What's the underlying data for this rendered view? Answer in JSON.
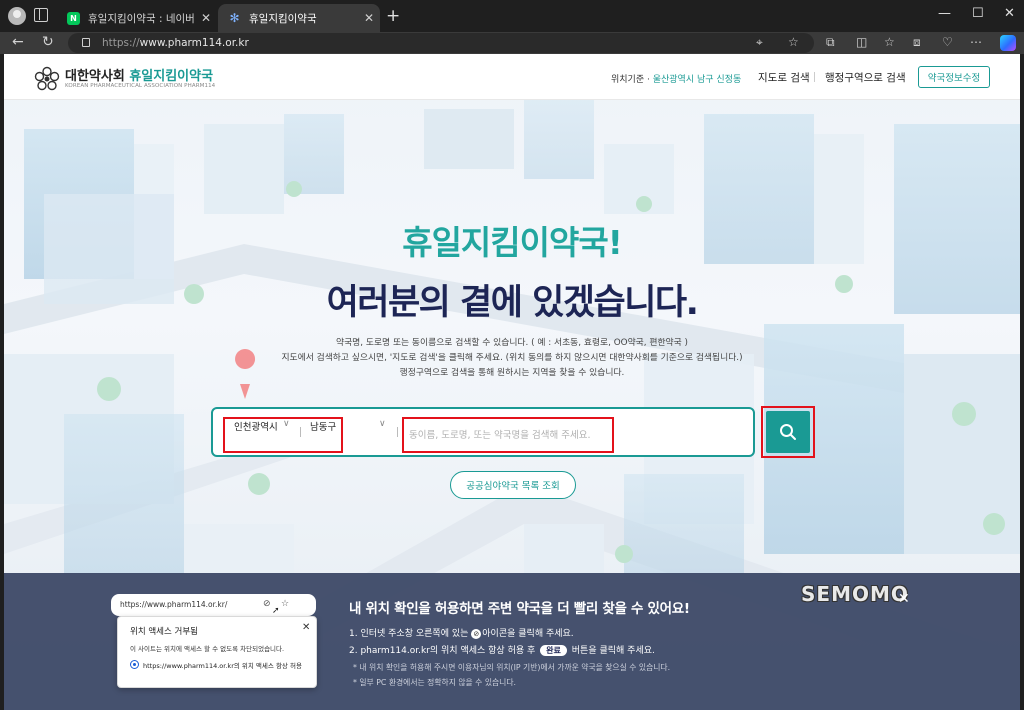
{
  "browser": {
    "tabs": [
      {
        "title": "휴일지킴이약국 : 네이버 검색",
        "favicon": "naver-icon",
        "active": false
      },
      {
        "title": "휴일지킴이약국",
        "favicon": "pharmacy-icon",
        "active": true
      }
    ],
    "url_prefix": "https://",
    "url_host": "www.pharm114.or.kr"
  },
  "header": {
    "logo_main": "대한약사회",
    "logo_accent": "휴일지킴이약국",
    "logo_sub": "KOREAN PHARMACEUTICAL ASSOCIATION PHARM114",
    "location_label": "위치기준 · ",
    "location_value": "울산광역시 남구 신정동",
    "nav_map_search": "지도로 검색",
    "nav_area_search": "행정구역으로 검색",
    "edit_button": "약국정보수정",
    "accent_color": "#1a9a94"
  },
  "hero": {
    "line1": "휴일지킴이약국!",
    "line2": "여러분의 곁에 있겠습니다.",
    "desc1": "약국명, 도로명 또는 동이름으로 검색할 수 있습니다. ( 예 : 서초동, 효령로, OO약국, 편한약국 )",
    "desc2": "지도에서 검색하고 싶으시면, '지도로 검색'을 클릭해 주세요. (위치 동의를 하지 않으시면 대한약사회를 기준으로 검색됩니다.)",
    "desc3": "행정구역으로 검색을 통해 원하시는 지역을 찾을 수 있습니다."
  },
  "search": {
    "city": "인천광역시",
    "district": "남동구",
    "placeholder": "동이름, 도로명, 또는 약국명을 검색해 주세요.",
    "list_button": "공공심야약국 목록 조회"
  },
  "banner": {
    "mock_url": "https://www.pharm114.or.kr/",
    "popup_title": "위치 액세스 거부됨",
    "popup_desc": "이 사이트는 위치에 액세스 할 수 없도록 차단되었습니다.",
    "popup_option": "https://www.pharm114.or.kr의 위치 액세스 항상 허용",
    "title": "내 위치 확인을 허용하면 주변 약국을 더 빨리 찾을 수 있어요!",
    "step1_a": "1. 인터넷 주소창 오른쪽에 있는",
    "step1_b": "아이콘을 클릭해 주세요.",
    "step2_a": "2. pharm114.or.kr의 위치 액세스 항상 허용 후",
    "step2_badge": "완료",
    "step2_b": "버튼을 클릭해 주세요.",
    "note1": "* 내 위치 확인을 허용해 주시면 이용자님의 위치(IP 기반)에서 가까운 약국을 찾으실 수 있습니다.",
    "note2": "* 일부 PC 환경에서는 정확하지 않을 수 있습니다."
  },
  "watermark": "SEMOMO"
}
